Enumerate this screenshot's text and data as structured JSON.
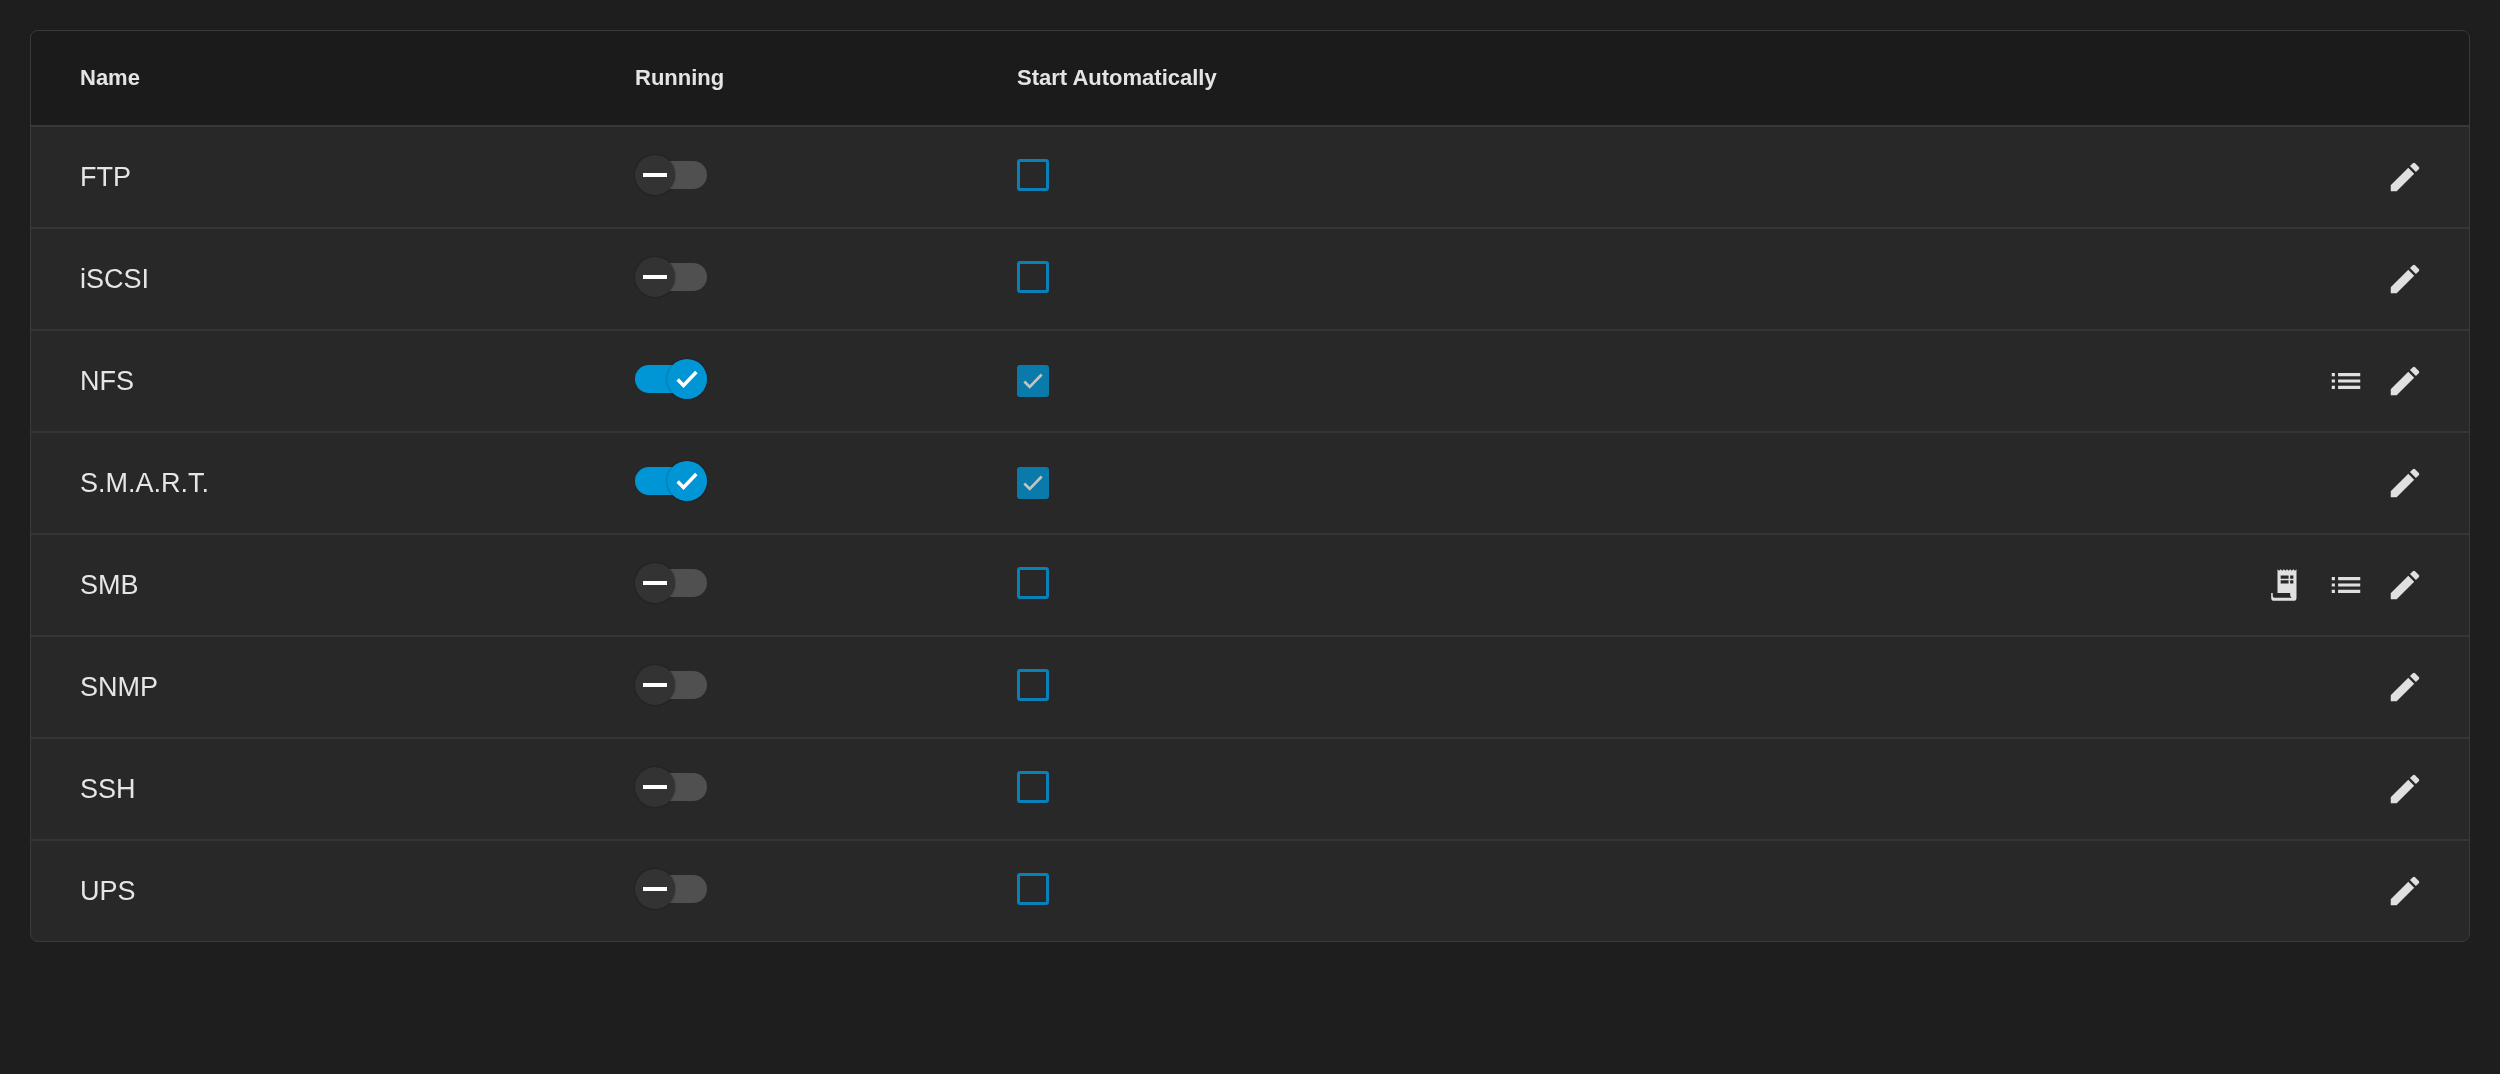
{
  "table": {
    "columns": [
      "Name",
      "Running",
      "Start Automatically"
    ],
    "rows": [
      {
        "name": "FTP",
        "running": false,
        "start_automatically": false,
        "actions": [
          {
            "kind": "edit"
          }
        ]
      },
      {
        "name": "iSCSI",
        "running": false,
        "start_automatically": false,
        "actions": [
          {
            "kind": "edit"
          }
        ]
      },
      {
        "name": "NFS",
        "running": true,
        "start_automatically": true,
        "actions": [
          {
            "kind": "list"
          },
          {
            "kind": "edit"
          }
        ]
      },
      {
        "name": "S.M.A.R.T.",
        "running": true,
        "start_automatically": true,
        "actions": [
          {
            "kind": "edit"
          }
        ]
      },
      {
        "name": "SMB",
        "running": false,
        "start_automatically": false,
        "actions": [
          {
            "kind": "logs"
          },
          {
            "kind": "list"
          },
          {
            "kind": "edit"
          }
        ]
      },
      {
        "name": "SNMP",
        "running": false,
        "start_automatically": false,
        "actions": [
          {
            "kind": "edit"
          }
        ]
      },
      {
        "name": "SSH",
        "running": false,
        "start_automatically": false,
        "actions": [
          {
            "kind": "edit"
          }
        ]
      },
      {
        "name": "UPS",
        "running": false,
        "start_automatically": false,
        "actions": [
          {
            "kind": "edit"
          }
        ]
      }
    ]
  }
}
